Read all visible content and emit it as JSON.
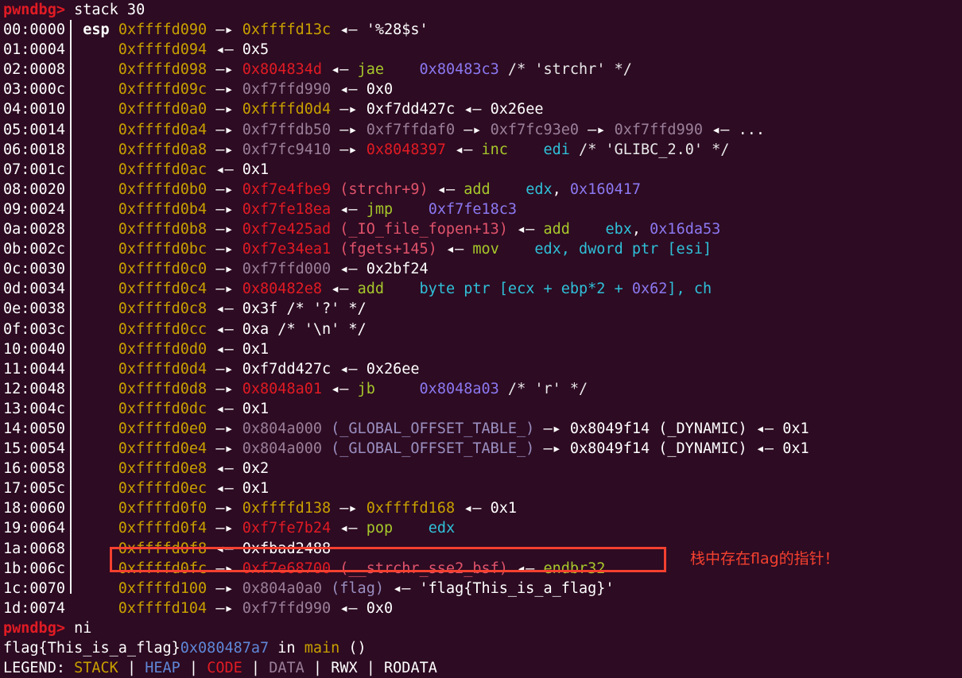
{
  "terminal": {
    "background": "#2d0b22",
    "foreground": "#ffffff",
    "prompt": "pwndbg>",
    "command_top": "stack 30",
    "command_bottom": "ni"
  },
  "palette": {
    "prompt": "#e01b24",
    "stack": "#c8a000",
    "code": "#e01b24",
    "data": "#9a7f9a",
    "heap": "#5f87d7",
    "instruction": "#a6c72b",
    "register": "#2fc0d8",
    "immediate": "#8b78f0",
    "symbol_code": "#e0536b",
    "annotation": "#f4402f"
  },
  "arrows": {
    "deref": "—▸",
    "value": "◂—"
  },
  "esp_label": "esp",
  "annotation": {
    "text": "栈中存在flag的指针！",
    "color": "#f4402f"
  },
  "stack_rows": [
    {
      "index": "00:0000",
      "reg": "esp",
      "addr": "0xffffd090",
      "rest_plain": " —▸ 0xffffd13c ◂— '%28$s'"
    },
    {
      "index": "01:0004",
      "reg": "",
      "addr": "0xffffd094",
      "rest_plain": " ◂— 0x5"
    },
    {
      "index": "02:0008",
      "reg": "",
      "addr": "0xffffd098",
      "rest_plain": " —▸ 0x804834d ◂— jae    0x80483c3 /* 'strchr' */"
    },
    {
      "index": "03:000c",
      "reg": "",
      "addr": "0xffffd09c",
      "rest_plain": " —▸ 0xf7ffd990 ◂— 0x0"
    },
    {
      "index": "04:0010",
      "reg": "",
      "addr": "0xffffd0a0",
      "rest_plain": " —▸ 0xffffd0d4 —▸ 0xf7dd427c ◂— 0x26ee"
    },
    {
      "index": "05:0014",
      "reg": "",
      "addr": "0xffffd0a4",
      "rest_plain": " —▸ 0xf7ffdb50 —▸ 0xf7ffdaf0 —▸ 0xf7fc93e0 —▸ 0xf7ffd990 ◂— ..."
    },
    {
      "index": "06:0018",
      "reg": "",
      "addr": "0xffffd0a8",
      "rest_plain": " —▸ 0xf7fc9410 —▸ 0x8048397 ◂— inc    edi /* 'GLIBC_2.0' */"
    },
    {
      "index": "07:001c",
      "reg": "",
      "addr": "0xffffd0ac",
      "rest_plain": " ◂— 0x1"
    },
    {
      "index": "08:0020",
      "reg": "",
      "addr": "0xffffd0b0",
      "rest_plain": " —▸ 0xf7e4fbe9 (strchr+9) ◂— add    edx, 0x160417"
    },
    {
      "index": "09:0024",
      "reg": "",
      "addr": "0xffffd0b4",
      "rest_plain": " —▸ 0xf7fe18ea ◂— jmp    0xf7fe18c3"
    },
    {
      "index": "0a:0028",
      "reg": "",
      "addr": "0xffffd0b8",
      "rest_plain": " —▸ 0xf7e425ad (_IO_file_fopen+13) ◂— add    ebx, 0x16da53"
    },
    {
      "index": "0b:002c",
      "reg": "",
      "addr": "0xffffd0bc",
      "rest_plain": " —▸ 0xf7e34ea1 (fgets+145) ◂— mov    edx, dword ptr [esi]"
    },
    {
      "index": "0c:0030",
      "reg": "",
      "addr": "0xffffd0c0",
      "rest_plain": " —▸ 0xf7ffd000 ◂— 0x2bf24"
    },
    {
      "index": "0d:0034",
      "reg": "",
      "addr": "0xffffd0c4",
      "rest_plain": " —▸ 0x80482e8 ◂— add    byte ptr [ecx + ebp*2 + 0x62], ch"
    },
    {
      "index": "0e:0038",
      "reg": "",
      "addr": "0xffffd0c8",
      "rest_plain": " ◂— 0x3f /* '?' */"
    },
    {
      "index": "0f:003c",
      "reg": "",
      "addr": "0xffffd0cc",
      "rest_plain": " ◂— 0xa /* '\\n' */"
    },
    {
      "index": "10:0040",
      "reg": "",
      "addr": "0xffffd0d0",
      "rest_plain": " ◂— 0x1"
    },
    {
      "index": "11:0044",
      "reg": "",
      "addr": "0xffffd0d4",
      "rest_plain": " —▸ 0xf7dd427c ◂— 0x26ee"
    },
    {
      "index": "12:0048",
      "reg": "",
      "addr": "0xffffd0d8",
      "rest_plain": " —▸ 0x8048a01 ◂— jb    0x8048a03 /* 'r' */"
    },
    {
      "index": "13:004c",
      "reg": "",
      "addr": "0xffffd0dc",
      "rest_plain": " ◂— 0x1"
    },
    {
      "index": "14:0050",
      "reg": "",
      "addr": "0xffffd0e0",
      "rest_plain": " —▸ 0x804a000 (_GLOBAL_OFFSET_TABLE_) —▸ 0x8049f14 (_DYNAMIC) ◂— 0x1"
    },
    {
      "index": "15:0054",
      "reg": "",
      "addr": "0xffffd0e4",
      "rest_plain": " —▸ 0x804a000 (_GLOBAL_OFFSET_TABLE_) —▸ 0x8049f14 (_DYNAMIC) ◂— 0x1"
    },
    {
      "index": "16:0058",
      "reg": "",
      "addr": "0xffffd0e8",
      "rest_plain": " ◂— 0x2"
    },
    {
      "index": "17:005c",
      "reg": "",
      "addr": "0xffffd0ec",
      "rest_plain": " ◂— 0x1"
    },
    {
      "index": "18:0060",
      "reg": "",
      "addr": "0xffffd0f0",
      "rest_plain": " —▸ 0xffffd138 —▸ 0xffffd168 ◂— 0x1"
    },
    {
      "index": "19:0064",
      "reg": "",
      "addr": "0xffffd0f4",
      "rest_plain": " —▸ 0xf7fe7b24 ◂— pop    edx"
    },
    {
      "index": "1a:0068",
      "reg": "",
      "addr": "0xffffd0f8",
      "rest_plain": " ◂— 0xfbad2488"
    },
    {
      "index": "1b:006c",
      "reg": "",
      "addr": "0xffffd0fc",
      "rest_plain": " —▸ 0xf7e68700 (__strchr_sse2_bsf) ◂— endbr32"
    },
    {
      "index": "1c:0070",
      "reg": "",
      "addr": "0xffffd100",
      "rest_plain": " —▸ 0x804a0a0 (flag) ◂— 'flag{This_is_a_flag}'"
    },
    {
      "index": "1d:0074",
      "reg": "",
      "addr": "0xffffd104",
      "rest_plain": " —▸ 0xf7ffd990 ◂— 0x0"
    }
  ],
  "output": {
    "flag_string": "flag{This_is_a_flag}",
    "stop_addr": "0x080487a7",
    "stop_in": " in ",
    "stop_func": "main",
    "stop_parens": " ()"
  },
  "legend": {
    "label": "LEGEND: ",
    "items": [
      "STACK",
      "HEAP",
      "CODE",
      "DATA",
      "RWX",
      "RODATA"
    ],
    "separator": " | "
  }
}
